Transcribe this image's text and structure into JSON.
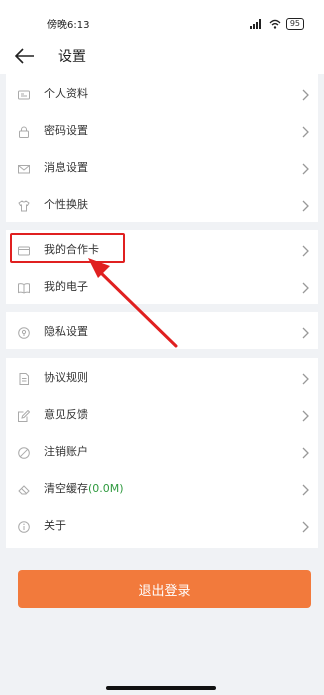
{
  "status_bar": {
    "time": "傍晚6:13",
    "signal_label": "HD",
    "battery": "95"
  },
  "header": {
    "title": "设置"
  },
  "groups": [
    {
      "items": [
        {
          "label": "个人资料",
          "icon": "id-card-icon"
        },
        {
          "label": "密码设置",
          "icon": "lock-icon"
        },
        {
          "label": "消息设置",
          "icon": "mail-icon"
        },
        {
          "label": "个性换肤",
          "icon": "shirt-icon"
        }
      ]
    },
    {
      "items": [
        {
          "label": "我的合作卡",
          "icon": "card-icon"
        },
        {
          "label": "我的电子",
          "icon": "book-icon"
        }
      ]
    },
    {
      "items": [
        {
          "label": "隐私设置",
          "icon": "privacy-icon"
        }
      ]
    },
    {
      "items": [
        {
          "label": "协议规则",
          "icon": "document-icon"
        },
        {
          "label": "意见反馈",
          "icon": "feedback-icon"
        },
        {
          "label": "注销账户",
          "icon": "cancel-icon"
        },
        {
          "label": "清空缓存",
          "value": "(0.0M)",
          "icon": "eraser-icon"
        },
        {
          "label": "关于",
          "icon": "info-icon"
        }
      ]
    }
  ],
  "logout": {
    "label": "退出登录"
  },
  "colors": {
    "accent": "#f27a3c",
    "highlight": "#e02020",
    "cache_value": "#2f9a3f"
  }
}
